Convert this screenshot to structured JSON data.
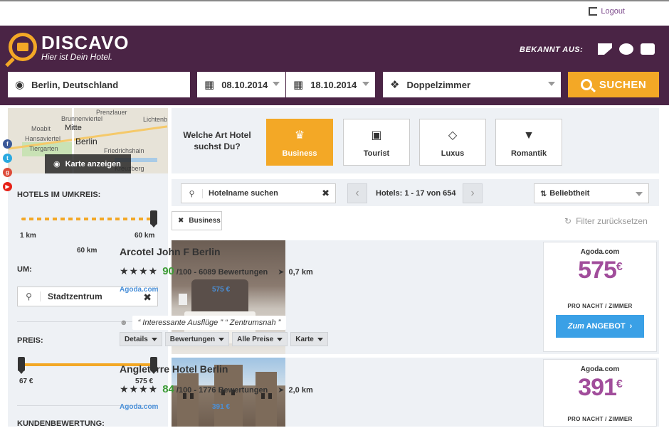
{
  "topbar": {
    "logout": "Logout"
  },
  "brand": {
    "name": "DISCAVO",
    "tagline": "Hier ist Dein Hotel."
  },
  "known_from": {
    "label": "BEKANNT AUS:"
  },
  "search": {
    "destination": "Berlin, Deutschland",
    "checkin": "08.10.2014",
    "checkout": "18.10.2014",
    "room": "Doppelzimmer",
    "button": "SUCHEN"
  },
  "map": {
    "button": "Karte anzeigen",
    "labels": [
      "Prenzlauer",
      "Brunnenviertel",
      "Moabit",
      "Mitte",
      "Hansaviertel",
      "Tiergarten",
      "Berlin",
      "Lichtenb",
      "Friedrichshain",
      "Kreuzberg"
    ]
  },
  "filters": {
    "radius_title": "HOTELS IM UMKREIS:",
    "radius_min": "1 km",
    "radius_max": "60 km",
    "radius_value": "60 km",
    "radius_fraction": 1.0,
    "um_title": "UM:",
    "um_value": "Stadtzentrum",
    "price_title": "PREIS:",
    "price_min": "67 €",
    "price_max": "575 €",
    "review_title": "KUNDENBEWERTUNG:"
  },
  "categories": {
    "question": "Welche Art Hotel suchst Du?",
    "items": [
      {
        "label": "Business",
        "icon": "business-icon",
        "active": true
      },
      {
        "label": "Tourist",
        "icon": "camera-icon",
        "active": false
      },
      {
        "label": "Luxus",
        "icon": "diamond-icon",
        "active": false
      },
      {
        "label": "Romantik",
        "icon": "wine-glass-icon",
        "active": false
      }
    ]
  },
  "toolbar": {
    "search_placeholder": "Hotelname suchen",
    "count": "Hotels: 1 - 17 von 654",
    "sort": "Beliebtheit"
  },
  "active_filter": {
    "label": "Business"
  },
  "reset": {
    "label": "Filter zurücksetzen"
  },
  "hotels": [
    {
      "name": "Arcotel John F Berlin",
      "stars": 4,
      "score": "90",
      "score_suffix": "/100 - 6089 Bewertungen",
      "distance": "0,7 km",
      "provider": "Agoda.com",
      "provider_price": "575 €",
      "tags": [
        "“ Interessante Ausflüge ”",
        "“ Zentrumsnah ”"
      ],
      "tabs": [
        "Details",
        "Bewertungen",
        "Alle Preise",
        "Karte"
      ],
      "price_provider": "Agoda.com",
      "price": "575",
      "currency": "€",
      "price_note": "PRO NACHT / ZIMMER",
      "offer_prefix": "Zum",
      "offer_label": "ANGEBOT"
    },
    {
      "name": "Angleterre Hotel Berlin",
      "stars": 4,
      "score": "84",
      "score_suffix": "/100 - 1776 Bewertungen",
      "distance": "2,0 km",
      "provider": "Agoda.com",
      "provider_price": "391 €",
      "price_provider": "Agoda.com",
      "price": "391",
      "currency": "€",
      "price_note": "PRO NACHT / ZIMMER"
    }
  ],
  "colors": {
    "header": "#4a2445",
    "accent": "#f3a826",
    "price": "#a14d9b",
    "link": "#4a90d9",
    "score": "#3c9b34",
    "cta": "#3aa0e6"
  }
}
